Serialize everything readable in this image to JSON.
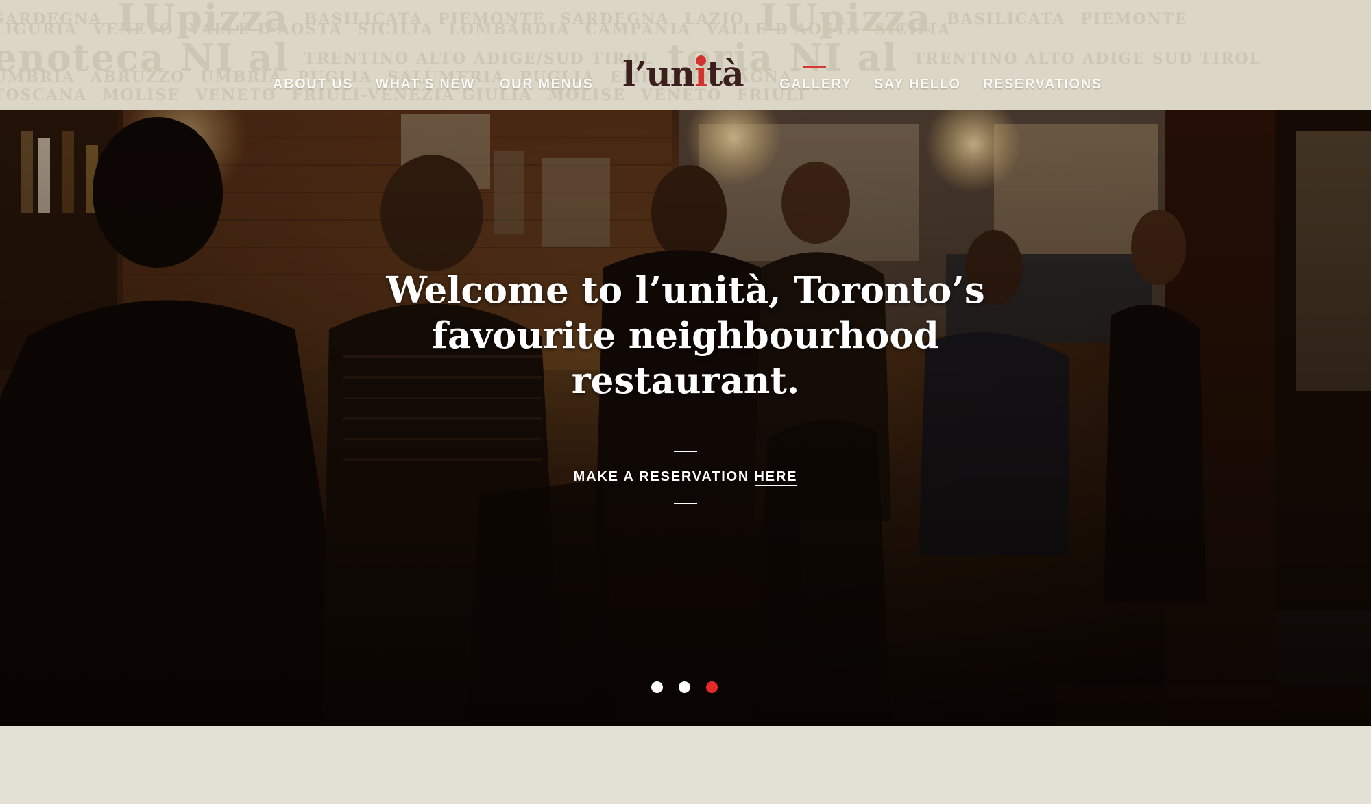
{
  "header": {
    "watermark_rows": [
      [
        "SARDEGNA",
        "LUpizza",
        "BASILICATA",
        "PIEMONTE",
        "SARDEGNA",
        "LAZIO",
        "LUpizza",
        "BASILICATA",
        "PIEMONTE"
      ],
      [
        "LIGURIA",
        "VENETO",
        "VALLE D'AOSTA",
        "SICILIA",
        "LOMBARDIA",
        "CAMPANIA",
        "VALLE D'AOSTA",
        "SICILIA"
      ],
      [
        "enoteca",
        "NI al",
        "TRENTINO ALTO ADIGE/SUD TIROL",
        "toria",
        "NI al",
        "TRENTINO ALTO ADIGE SUD TIROL"
      ],
      [
        "UMBRIA",
        "ABRUZZO",
        "UMBRIA",
        "PUGLIA",
        "SALUMERIA",
        "PUGLIA",
        "EMILIA-ROMAGNA"
      ],
      [
        "TOSCANA",
        "MOLISE",
        "VENETO",
        "FRIULI-VENEZIA GIULIA",
        "MOLISE",
        "VENETO",
        "FRIULI"
      ]
    ]
  },
  "nav": {
    "items": [
      "ABOUT US",
      "WHAT'S NEW",
      "OUR MENUS",
      "GALLERY",
      "SAY HELLO",
      "RESERVATIONS"
    ],
    "active": "GALLERY"
  },
  "logo": {
    "part1": "l’un",
    "accent": "i",
    "part2": "tà"
  },
  "hero": {
    "headline_lines": [
      "Welcome to l’unità, Toronto’s",
      "favourite neighbourhood",
      "restaurant."
    ],
    "cta_prefix": "MAKE A RESERVATION ",
    "cta_link": "HERE",
    "slides": 3,
    "active_slide": 3
  },
  "colors": {
    "accent_red": "#d3322f",
    "header_bg": "#dbd6c6",
    "page_bg": "#e2dfd4",
    "logo_dark": "#3a1f1c"
  }
}
